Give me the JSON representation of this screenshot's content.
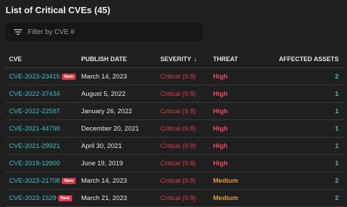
{
  "header": {
    "title": "List of Critical CVEs (45)"
  },
  "filter": {
    "placeholder": "Filter by CVE #"
  },
  "columns": {
    "cve": "CVE",
    "publish_date": "PUBLISH DATE",
    "severity": "SEVERITY",
    "threat": "THREAT",
    "affected_assets": "AFFECTED ASSETS"
  },
  "badge_label": "New",
  "colors": {
    "accent": "#3fc1c9",
    "critical": "#e23b49",
    "high": "#f24a5c",
    "medium": "#e89a2c",
    "new_badge": "#e0344a"
  },
  "rows": [
    {
      "cve": "CVE-2023-23415",
      "new": true,
      "date": "March 14, 2023",
      "severity": "Critical (9.8)",
      "threat": "High",
      "assets": "2"
    },
    {
      "cve": "CVE-2022-37434",
      "new": false,
      "date": "August 5, 2022",
      "severity": "Critical (9.8)",
      "threat": "High",
      "assets": "1"
    },
    {
      "cve": "CVE-2022-22587",
      "new": false,
      "date": "January 26, 2022",
      "severity": "Critical (9.8)",
      "threat": "High",
      "assets": "1"
    },
    {
      "cve": "CVE-2021-44790",
      "new": false,
      "date": "December 20, 2021",
      "severity": "Critical (9.8)",
      "threat": "High",
      "assets": "1"
    },
    {
      "cve": "CVE-2021-29921",
      "new": false,
      "date": "April 30, 2021",
      "severity": "Critical (9.8)",
      "threat": "High",
      "assets": "1"
    },
    {
      "cve": "CVE-2019-12900",
      "new": false,
      "date": "June 19, 2019",
      "severity": "Critical (9.8)",
      "threat": "High",
      "assets": "1"
    },
    {
      "cve": "CVE-2023-21708",
      "new": true,
      "date": "March 14, 2023",
      "severity": "Critical (9.8)",
      "threat": "Medium",
      "assets": "2"
    },
    {
      "cve": "CVE-2023-1529",
      "new": true,
      "date": "March 21, 2023",
      "severity": "Critical (9.8)",
      "threat": "Medium",
      "assets": "2"
    }
  ]
}
